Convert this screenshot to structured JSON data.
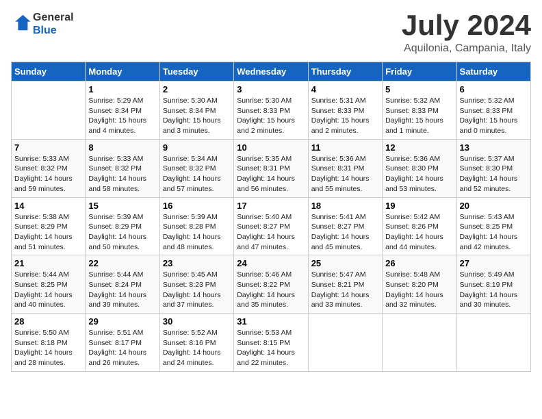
{
  "header": {
    "logo_general": "General",
    "logo_blue": "Blue",
    "month": "July 2024",
    "location": "Aquilonia, Campania, Italy"
  },
  "weekdays": [
    "Sunday",
    "Monday",
    "Tuesday",
    "Wednesday",
    "Thursday",
    "Friday",
    "Saturday"
  ],
  "weeks": [
    [
      {
        "day": "",
        "info": ""
      },
      {
        "day": "1",
        "info": "Sunrise: 5:29 AM\nSunset: 8:34 PM\nDaylight: 15 hours\nand 4 minutes."
      },
      {
        "day": "2",
        "info": "Sunrise: 5:30 AM\nSunset: 8:34 PM\nDaylight: 15 hours\nand 3 minutes."
      },
      {
        "day": "3",
        "info": "Sunrise: 5:30 AM\nSunset: 8:33 PM\nDaylight: 15 hours\nand 2 minutes."
      },
      {
        "day": "4",
        "info": "Sunrise: 5:31 AM\nSunset: 8:33 PM\nDaylight: 15 hours\nand 2 minutes."
      },
      {
        "day": "5",
        "info": "Sunrise: 5:32 AM\nSunset: 8:33 PM\nDaylight: 15 hours\nand 1 minute."
      },
      {
        "day": "6",
        "info": "Sunrise: 5:32 AM\nSunset: 8:33 PM\nDaylight: 15 hours\nand 0 minutes."
      }
    ],
    [
      {
        "day": "7",
        "info": "Sunrise: 5:33 AM\nSunset: 8:32 PM\nDaylight: 14 hours\nand 59 minutes."
      },
      {
        "day": "8",
        "info": "Sunrise: 5:33 AM\nSunset: 8:32 PM\nDaylight: 14 hours\nand 58 minutes."
      },
      {
        "day": "9",
        "info": "Sunrise: 5:34 AM\nSunset: 8:32 PM\nDaylight: 14 hours\nand 57 minutes."
      },
      {
        "day": "10",
        "info": "Sunrise: 5:35 AM\nSunset: 8:31 PM\nDaylight: 14 hours\nand 56 minutes."
      },
      {
        "day": "11",
        "info": "Sunrise: 5:36 AM\nSunset: 8:31 PM\nDaylight: 14 hours\nand 55 minutes."
      },
      {
        "day": "12",
        "info": "Sunrise: 5:36 AM\nSunset: 8:30 PM\nDaylight: 14 hours\nand 53 minutes."
      },
      {
        "day": "13",
        "info": "Sunrise: 5:37 AM\nSunset: 8:30 PM\nDaylight: 14 hours\nand 52 minutes."
      }
    ],
    [
      {
        "day": "14",
        "info": "Sunrise: 5:38 AM\nSunset: 8:29 PM\nDaylight: 14 hours\nand 51 minutes."
      },
      {
        "day": "15",
        "info": "Sunrise: 5:39 AM\nSunset: 8:29 PM\nDaylight: 14 hours\nand 50 minutes."
      },
      {
        "day": "16",
        "info": "Sunrise: 5:39 AM\nSunset: 8:28 PM\nDaylight: 14 hours\nand 48 minutes."
      },
      {
        "day": "17",
        "info": "Sunrise: 5:40 AM\nSunset: 8:27 PM\nDaylight: 14 hours\nand 47 minutes."
      },
      {
        "day": "18",
        "info": "Sunrise: 5:41 AM\nSunset: 8:27 PM\nDaylight: 14 hours\nand 45 minutes."
      },
      {
        "day": "19",
        "info": "Sunrise: 5:42 AM\nSunset: 8:26 PM\nDaylight: 14 hours\nand 44 minutes."
      },
      {
        "day": "20",
        "info": "Sunrise: 5:43 AM\nSunset: 8:25 PM\nDaylight: 14 hours\nand 42 minutes."
      }
    ],
    [
      {
        "day": "21",
        "info": "Sunrise: 5:44 AM\nSunset: 8:25 PM\nDaylight: 14 hours\nand 40 minutes."
      },
      {
        "day": "22",
        "info": "Sunrise: 5:44 AM\nSunset: 8:24 PM\nDaylight: 14 hours\nand 39 minutes."
      },
      {
        "day": "23",
        "info": "Sunrise: 5:45 AM\nSunset: 8:23 PM\nDaylight: 14 hours\nand 37 minutes."
      },
      {
        "day": "24",
        "info": "Sunrise: 5:46 AM\nSunset: 8:22 PM\nDaylight: 14 hours\nand 35 minutes."
      },
      {
        "day": "25",
        "info": "Sunrise: 5:47 AM\nSunset: 8:21 PM\nDaylight: 14 hours\nand 33 minutes."
      },
      {
        "day": "26",
        "info": "Sunrise: 5:48 AM\nSunset: 8:20 PM\nDaylight: 14 hours\nand 32 minutes."
      },
      {
        "day": "27",
        "info": "Sunrise: 5:49 AM\nSunset: 8:19 PM\nDaylight: 14 hours\nand 30 minutes."
      }
    ],
    [
      {
        "day": "28",
        "info": "Sunrise: 5:50 AM\nSunset: 8:18 PM\nDaylight: 14 hours\nand 28 minutes."
      },
      {
        "day": "29",
        "info": "Sunrise: 5:51 AM\nSunset: 8:17 PM\nDaylight: 14 hours\nand 26 minutes."
      },
      {
        "day": "30",
        "info": "Sunrise: 5:52 AM\nSunset: 8:16 PM\nDaylight: 14 hours\nand 24 minutes."
      },
      {
        "day": "31",
        "info": "Sunrise: 5:53 AM\nSunset: 8:15 PM\nDaylight: 14 hours\nand 22 minutes."
      },
      {
        "day": "",
        "info": ""
      },
      {
        "day": "",
        "info": ""
      },
      {
        "day": "",
        "info": ""
      }
    ]
  ]
}
